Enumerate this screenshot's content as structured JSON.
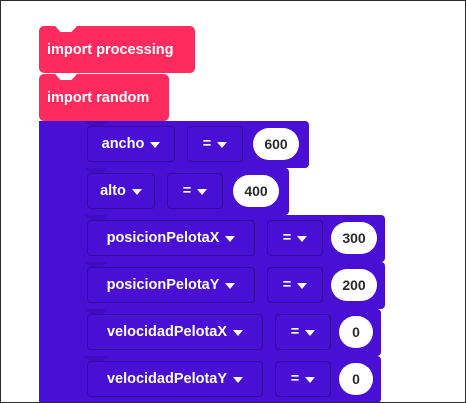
{
  "imports": [
    {
      "label": "import processing"
    },
    {
      "label": "import random"
    }
  ],
  "assignments": [
    {
      "variable": "ancho",
      "operator": "=",
      "value": "600"
    },
    {
      "variable": "alto",
      "operator": "=",
      "value": "400"
    },
    {
      "variable": "posicionPelotaX",
      "operator": "=",
      "value": "300"
    },
    {
      "variable": "posicionPelotaY",
      "operator": "=",
      "value": "200"
    },
    {
      "variable": "velocidadPelotaX",
      "operator": "=",
      "value": "0"
    },
    {
      "variable": "velocidadPelotaY",
      "operator": "=",
      "value": "0"
    }
  ],
  "colors": {
    "import_block": "#ff2a5e",
    "assign_block": "#4a0fd4",
    "value_bubble": "#ffffff"
  },
  "icons": {
    "dropdown": "caret-down-icon"
  }
}
